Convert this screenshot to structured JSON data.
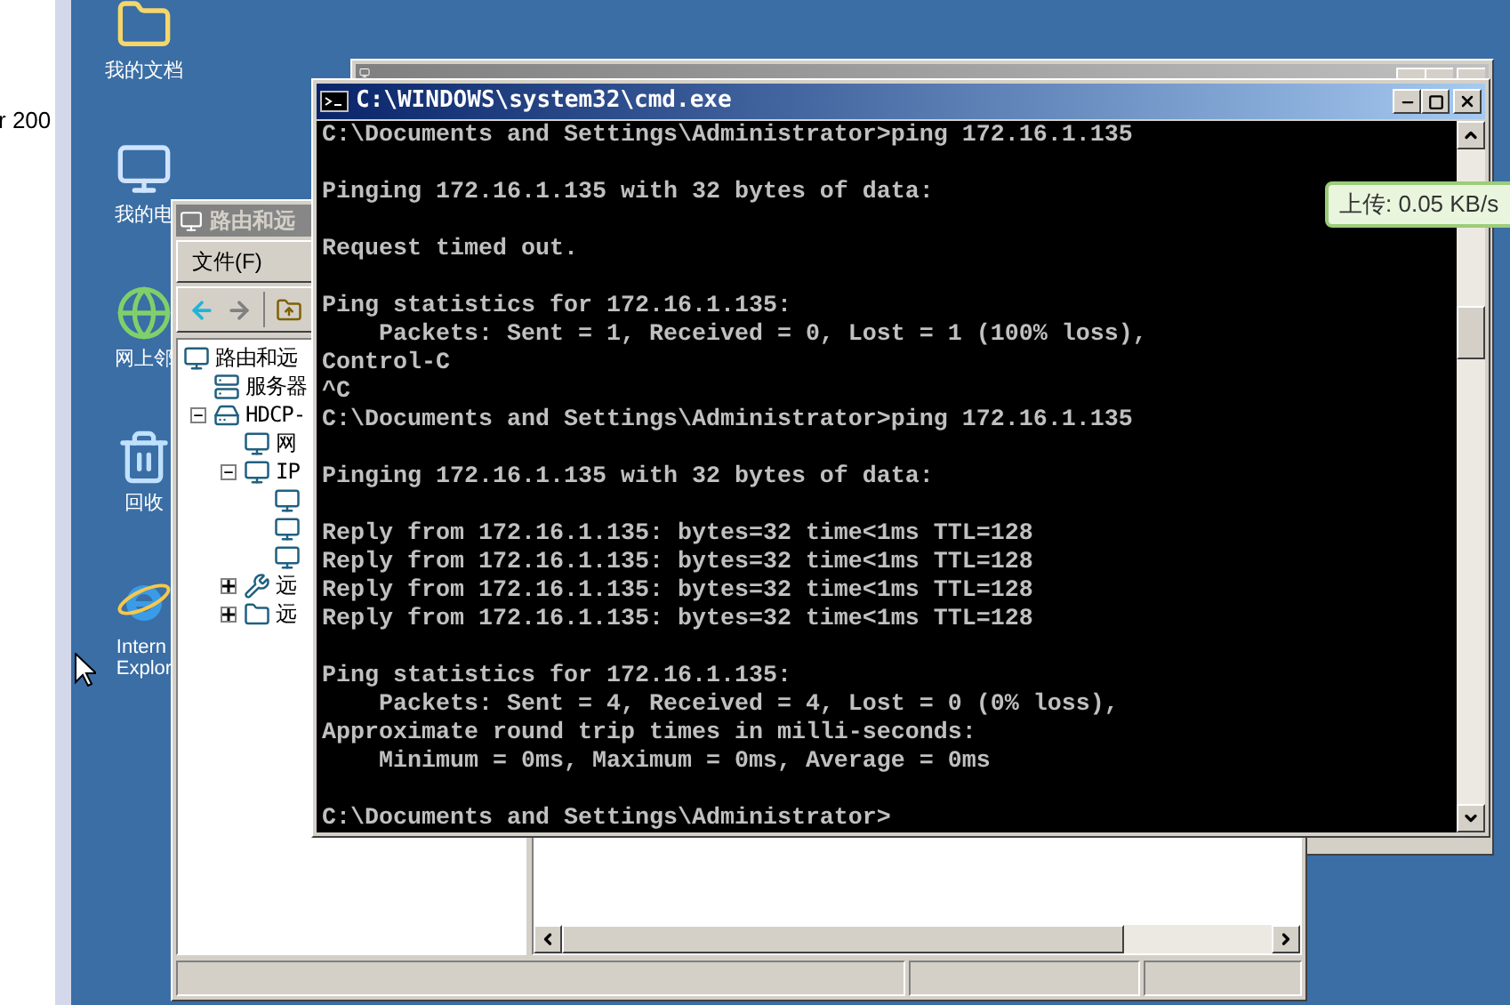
{
  "left_window": {
    "text": "r 200"
  },
  "desktop_icons": [
    {
      "kind": "documents",
      "label": [
        "我的文档"
      ]
    },
    {
      "kind": "computer",
      "label": [
        "我的电"
      ]
    },
    {
      "kind": "network",
      "label": [
        "网上邻"
      ]
    },
    {
      "kind": "recycle",
      "label": [
        "回收"
      ]
    },
    {
      "kind": "browser",
      "label": [
        "Intern",
        "Explor"
      ]
    }
  ],
  "routing_window": {
    "title": "路由和远",
    "menu": [
      "文件(F)"
    ],
    "tree": [
      {
        "kind": "root",
        "label": "路由和远",
        "children": [
          {
            "kind": "servers",
            "label": "服务器"
          },
          {
            "kind": "server",
            "label": "HDCP-",
            "expanded": true,
            "children": [
              {
                "kind": "node",
                "label": "网"
              },
              {
                "kind": "node",
                "label": "IP",
                "expanded": true,
                "children": [
                  {
                    "kind": "node"
                  },
                  {
                    "kind": "node"
                  },
                  {
                    "kind": "node"
                  }
                ]
              },
              {
                "kind": "policy",
                "label": "远",
                "expanded": false
              },
              {
                "kind": "folder",
                "label": "远",
                "expanded": false
              }
            ]
          }
        ]
      }
    ]
  },
  "cmd_window": {
    "title": "C:\\WINDOWS\\system32\\cmd.exe",
    "paragraphs": [
      [
        "C:\\Documents and Settings\\Administrator>ping 172.16.1.135"
      ],
      [
        "Pinging 172.16.1.135 with 32 bytes of data:"
      ],
      [
        "Request timed out."
      ],
      [
        "Ping statistics for 172.16.1.135:",
        "    Packets: Sent = 1, Received = 0, Lost = 1 (100% loss),",
        "Control-C",
        "^C",
        "C:\\Documents and Settings\\Administrator>ping 172.16.1.135"
      ],
      [
        "Pinging 172.16.1.135 with 32 bytes of data:"
      ],
      [
        "Reply from 172.16.1.135: bytes=32 time<1ms TTL=128",
        "Reply from 172.16.1.135: bytes=32 time<1ms TTL=128",
        "Reply from 172.16.1.135: bytes=32 time<1ms TTL=128",
        "Reply from 172.16.1.135: bytes=32 time<1ms TTL=128"
      ],
      [
        "Ping statistics for 172.16.1.135:",
        "    Packets: Sent = 4, Received = 4, Lost = 0 (0% loss),",
        "Approximate round trip times in milli-seconds:",
        "    Minimum = 0ms, Maximum = 0ms, Average = 0ms"
      ],
      [
        "C:\\Documents and Settings\\Administrator>"
      ]
    ]
  },
  "tooltip": {
    "text": "上传: 0.05 KB/s"
  }
}
